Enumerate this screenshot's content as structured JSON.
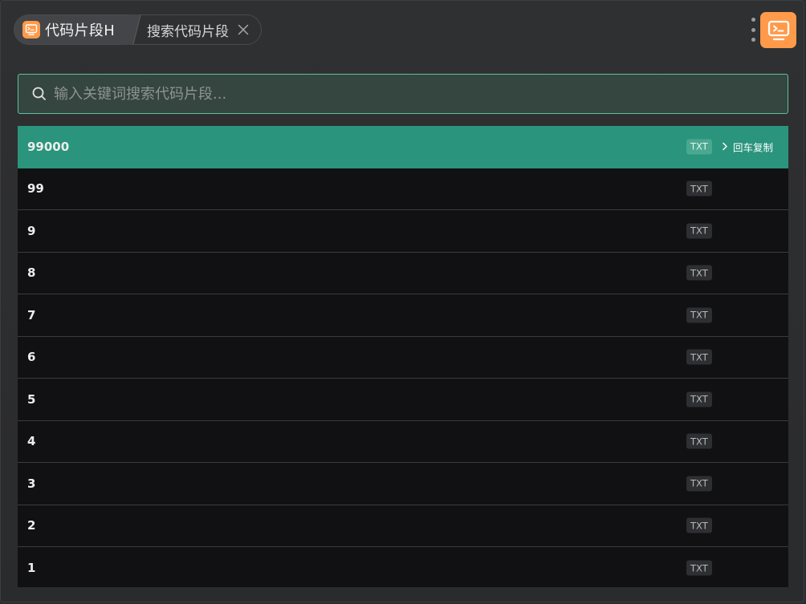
{
  "header": {
    "app_name": "代码片段H",
    "search_crumb_label": "搜索代码片段"
  },
  "search": {
    "placeholder": "输入关键词搜索代码片段...",
    "value": ""
  },
  "list": {
    "items": [
      {
        "title": "99000",
        "badge": "TXT",
        "hint": "回车复制",
        "selected": true
      },
      {
        "title": "99",
        "badge": "TXT"
      },
      {
        "title": "9",
        "badge": "TXT"
      },
      {
        "title": "8",
        "badge": "TXT"
      },
      {
        "title": "7",
        "badge": "TXT"
      },
      {
        "title": "6",
        "badge": "TXT"
      },
      {
        "title": "5",
        "badge": "TXT"
      },
      {
        "title": "4",
        "badge": "TXT"
      },
      {
        "title": "3",
        "badge": "TXT"
      },
      {
        "title": "2",
        "badge": "TXT"
      },
      {
        "title": "1",
        "badge": "TXT"
      }
    ]
  },
  "colors": {
    "accent": "#2a947c",
    "app_icon": "#ff9a4a",
    "search_border": "#5fbf9d"
  },
  "icons": {
    "app": "terminal-monitor-icon",
    "close": "close-icon",
    "more": "more-vertical-icon",
    "search": "search-icon",
    "hint": "chevron-right-icon"
  }
}
